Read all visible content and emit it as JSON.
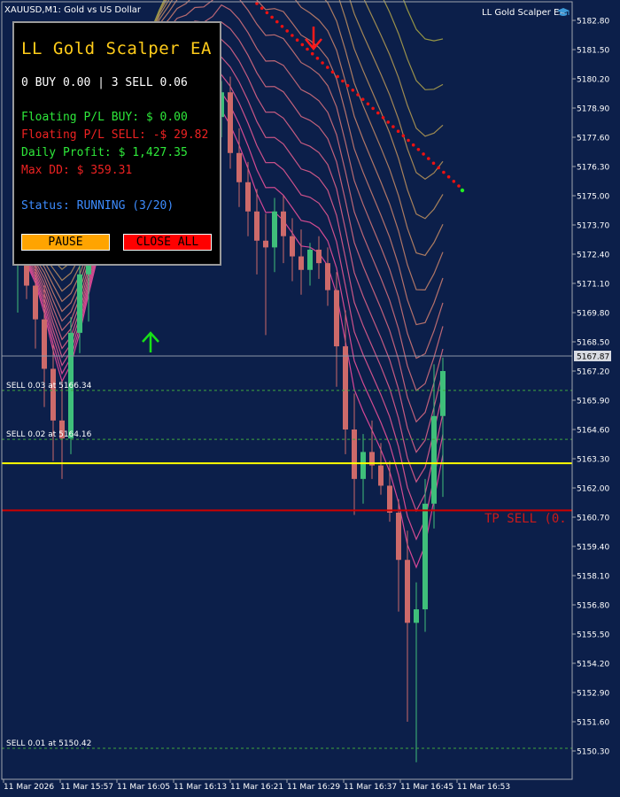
{
  "window": {
    "symbol_title": "XAUUSD,M1:  Gold vs US Dollar",
    "ea_name": "LL Gold Scalper EA"
  },
  "panel": {
    "title": "LL Gold Scalper EA",
    "positions": "0 BUY 0.00 | 3 SELL 0.06",
    "floating_buy": "Floating P/L BUY: $ 0.00",
    "floating_sell": "Floating P/L SELL: -$ 29.82",
    "daily_profit": "Daily Profit: $ 1,427.35",
    "max_dd": "Max DD: $ 359.31",
    "status": "Status: RUNNING (3/20)",
    "pause_label": "PAUSE",
    "close_all_label": "CLOSE ALL"
  },
  "colors": {
    "background": "#0c1f4a",
    "bull": "#3fbf7a",
    "bear": "#cd6a6a",
    "title_yellow": "#ffcc1a",
    "green_text": "#2ee83a",
    "red_text": "#ee2222",
    "status_blue": "#3d8cff",
    "pause_bg": "#ffa400",
    "close_bg": "#ff0000",
    "yellow_line": "#ffff00",
    "tp_line": "#cc0000"
  },
  "price_axis": {
    "ticks": [
      "5182.80",
      "5181.50",
      "5180.20",
      "5178.90",
      "5177.60",
      "5176.30",
      "5175.00",
      "5173.70",
      "5172.40",
      "5171.10",
      "5169.80",
      "5168.50",
      "5167.20",
      "5165.90",
      "5164.60",
      "5163.30",
      "5162.00",
      "5160.70",
      "5159.40",
      "5158.10",
      "5156.80",
      "5155.50",
      "5154.20",
      "5152.90",
      "5151.60",
      "5150.30"
    ],
    "current_price": "5167.87"
  },
  "time_axis": {
    "ticks": [
      "11 Mar 2026",
      "11 Mar 15:57",
      "11 Mar 16:05",
      "11 Mar 16:13",
      "11 Mar 16:21",
      "11 Mar 16:29",
      "11 Mar 16:37",
      "11 Mar 16:45",
      "11 Mar 16:53"
    ]
  },
  "orders": [
    {
      "label": "SELL 0.03 at 5166.34",
      "price": 5166.34
    },
    {
      "label": "SELL 0.02 at 5164.16",
      "price": 5164.16
    },
    {
      "label": "SELL 0.01 at 5150.42",
      "price": 5150.42
    }
  ],
  "levels": {
    "yellow_line_price": 5163.1,
    "tp_line_price": 5161.0,
    "tp_label": "TP SELL (0."
  },
  "chart_data": {
    "type": "candlestick",
    "symbol": "XAUUSD",
    "timeframe": "M1",
    "y_range": [
      5149.6,
      5183.4
    ],
    "candles": [
      {
        "o": 5172.0,
        "h": 5175.5,
        "l": 5169.8,
        "c": 5172.5
      },
      {
        "o": 5172.5,
        "h": 5174.2,
        "l": 5170.4,
        "c": 5171.0
      },
      {
        "o": 5171.0,
        "h": 5172.8,
        "l": 5168.2,
        "c": 5169.5
      },
      {
        "o": 5169.5,
        "h": 5171.0,
        "l": 5165.6,
        "c": 5167.3
      },
      {
        "o": 5167.3,
        "h": 5168.4,
        "l": 5163.2,
        "c": 5165.0
      },
      {
        "o": 5165.0,
        "h": 5166.8,
        "l": 5162.4,
        "c": 5164.2
      },
      {
        "o": 5164.2,
        "h": 5169.6,
        "l": 5163.5,
        "c": 5168.9
      },
      {
        "o": 5168.9,
        "h": 5172.3,
        "l": 5168.0,
        "c": 5171.5
      },
      {
        "o": 5171.5,
        "h": 5174.5,
        "l": 5169.4,
        "c": 5173.8
      },
      {
        "o": 5173.8,
        "h": 5176.4,
        "l": 5172.6,
        "c": 5175.2
      },
      {
        "o": 5175.2,
        "h": 5178.1,
        "l": 5174.5,
        "c": 5177.3
      },
      {
        "o": 5177.3,
        "h": 5180.6,
        "l": 5176.5,
        "c": 5179.6
      },
      {
        "o": 5179.6,
        "h": 5181.6,
        "l": 5178.5,
        "c": 5180.8
      },
      {
        "o": 5180.8,
        "h": 5181.5,
        "l": 5178.9,
        "c": 5179.3
      },
      {
        "o": 5179.3,
        "h": 5181.2,
        "l": 5178.6,
        "c": 5180.2
      },
      {
        "o": 5180.2,
        "h": 5180.9,
        "l": 5178.4,
        "c": 5179.0
      },
      {
        "o": 5179.0,
        "h": 5180.6,
        "l": 5178.2,
        "c": 5179.9
      },
      {
        "o": 5179.9,
        "h": 5180.4,
        "l": 5177.8,
        "c": 5178.6
      },
      {
        "o": 5178.6,
        "h": 5179.8,
        "l": 5177.6,
        "c": 5179.2
      },
      {
        "o": 5179.2,
        "h": 5179.7,
        "l": 5177.4,
        "c": 5178.0
      },
      {
        "o": 5178.0,
        "h": 5179.4,
        "l": 5177.0,
        "c": 5178.8
      },
      {
        "o": 5178.8,
        "h": 5179.5,
        "l": 5176.9,
        "c": 5177.5
      },
      {
        "o": 5177.5,
        "h": 5179.0,
        "l": 5176.8,
        "c": 5178.5
      },
      {
        "o": 5178.5,
        "h": 5180.1,
        "l": 5177.6,
        "c": 5179.6
      },
      {
        "o": 5179.6,
        "h": 5180.3,
        "l": 5176.2,
        "c": 5176.9
      },
      {
        "o": 5176.9,
        "h": 5178.0,
        "l": 5174.5,
        "c": 5175.6
      },
      {
        "o": 5175.6,
        "h": 5176.5,
        "l": 5173.2,
        "c": 5174.3
      },
      {
        "o": 5174.3,
        "h": 5175.3,
        "l": 5171.5,
        "c": 5173.0
      },
      {
        "o": 5173.0,
        "h": 5174.2,
        "l": 5168.8,
        "c": 5172.7
      },
      {
        "o": 5172.7,
        "h": 5174.9,
        "l": 5171.6,
        "c": 5174.3
      },
      {
        "o": 5174.3,
        "h": 5175.0,
        "l": 5172.0,
        "c": 5173.2
      },
      {
        "o": 5173.2,
        "h": 5174.0,
        "l": 5171.2,
        "c": 5172.3
      },
      {
        "o": 5172.3,
        "h": 5173.5,
        "l": 5170.6,
        "c": 5171.7
      },
      {
        "o": 5171.7,
        "h": 5172.9,
        "l": 5171.0,
        "c": 5172.6
      },
      {
        "o": 5172.6,
        "h": 5173.2,
        "l": 5171.3,
        "c": 5172.0
      },
      {
        "o": 5172.0,
        "h": 5172.7,
        "l": 5170.1,
        "c": 5170.8
      },
      {
        "o": 5170.8,
        "h": 5171.6,
        "l": 5166.5,
        "c": 5168.3
      },
      {
        "o": 5168.3,
        "h": 5169.9,
        "l": 5163.5,
        "c": 5164.6
      },
      {
        "o": 5164.6,
        "h": 5166.2,
        "l": 5160.8,
        "c": 5162.4
      },
      {
        "o": 5162.4,
        "h": 5164.4,
        "l": 5161.3,
        "c": 5163.6
      },
      {
        "o": 5163.6,
        "h": 5165.0,
        "l": 5162.4,
        "c": 5163.0
      },
      {
        "o": 5163.0,
        "h": 5164.0,
        "l": 5161.7,
        "c": 5162.1
      },
      {
        "o": 5162.1,
        "h": 5163.2,
        "l": 5160.5,
        "c": 5160.9
      },
      {
        "o": 5160.9,
        "h": 5161.5,
        "l": 5156.5,
        "c": 5158.8
      },
      {
        "o": 5158.8,
        "h": 5160.1,
        "l": 5151.6,
        "c": 5156.0
      },
      {
        "o": 5156.0,
        "h": 5157.8,
        "l": 5149.8,
        "c": 5156.6
      },
      {
        "o": 5156.6,
        "h": 5162.4,
        "l": 5155.6,
        "c": 5161.3
      },
      {
        "o": 5161.3,
        "h": 5167.5,
        "l": 5160.2,
        "c": 5165.2
      },
      {
        "o": 5165.2,
        "h": 5167.8,
        "l": 5161.6,
        "c": 5167.2
      }
    ]
  }
}
